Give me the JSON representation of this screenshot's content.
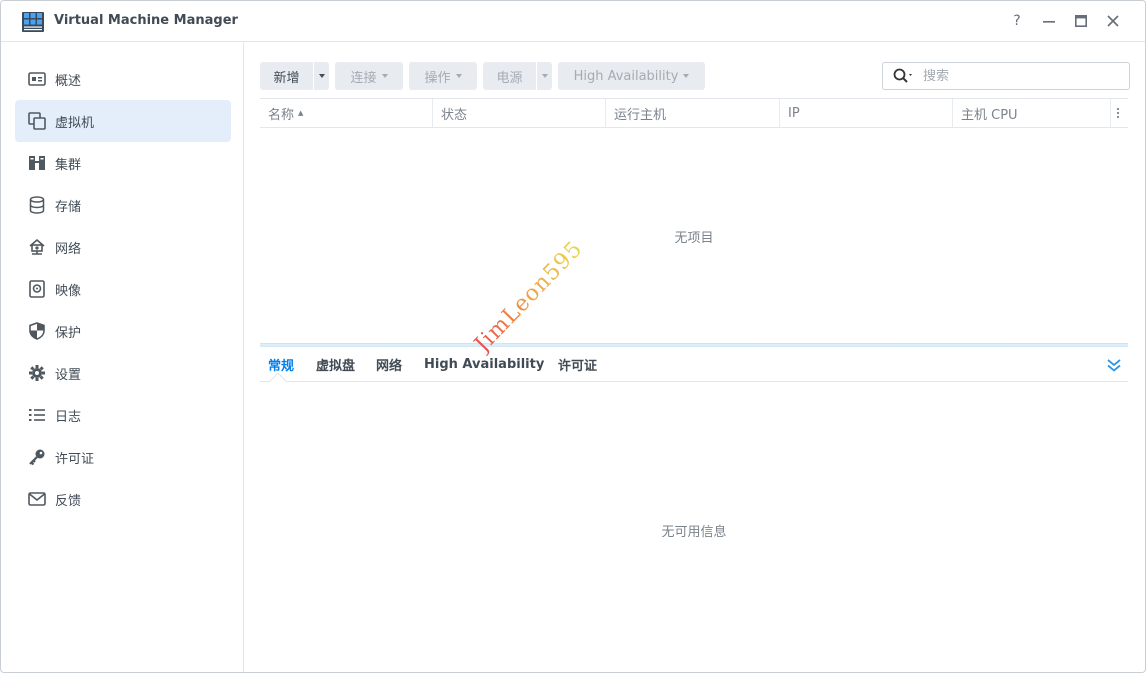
{
  "window": {
    "title": "Virtual Machine Manager",
    "controls": [
      "help-icon",
      "minimize-icon",
      "maximize-icon",
      "close-icon"
    ],
    "help_label": "?"
  },
  "sidebar": {
    "items": [
      {
        "label": "概述",
        "icon": "overview-icon",
        "active": false
      },
      {
        "label": "虚拟机",
        "icon": "vm-icon",
        "active": true
      },
      {
        "label": "集群",
        "icon": "cluster-icon",
        "active": false
      },
      {
        "label": "存储",
        "icon": "storage-icon",
        "active": false
      },
      {
        "label": "网络",
        "icon": "network-icon",
        "active": false
      },
      {
        "label": "映像",
        "icon": "image-icon",
        "active": false
      },
      {
        "label": "保护",
        "icon": "shield-icon",
        "active": false
      },
      {
        "label": "设置",
        "icon": "gear-icon",
        "active": false
      },
      {
        "label": "日志",
        "icon": "log-icon",
        "active": false
      },
      {
        "label": "许可证",
        "icon": "key-icon",
        "active": false
      },
      {
        "label": "反馈",
        "icon": "mail-icon",
        "active": false
      }
    ]
  },
  "toolbar": {
    "create_label": "新增",
    "connect_label": "连接",
    "action_label": "操作",
    "power_label": "电源",
    "ha_label": "High Availability"
  },
  "search": {
    "placeholder": "搜索"
  },
  "grid": {
    "columns": [
      "名称",
      "状态",
      "运行主机",
      "IP",
      "主机 CPU"
    ],
    "sort_indicator": "▲",
    "empty_text": "无项目"
  },
  "detail": {
    "tabs": [
      "常规",
      "虚拟盘",
      "网络",
      "High Availability",
      "许可证"
    ],
    "active_tab": "常规",
    "empty_text": "无可用信息"
  },
  "watermark": "JimLeon595",
  "colors": {
    "accent": "#057feb",
    "active_nav_bg": "#e3eefa",
    "button_bg": "#e8ecf0"
  }
}
